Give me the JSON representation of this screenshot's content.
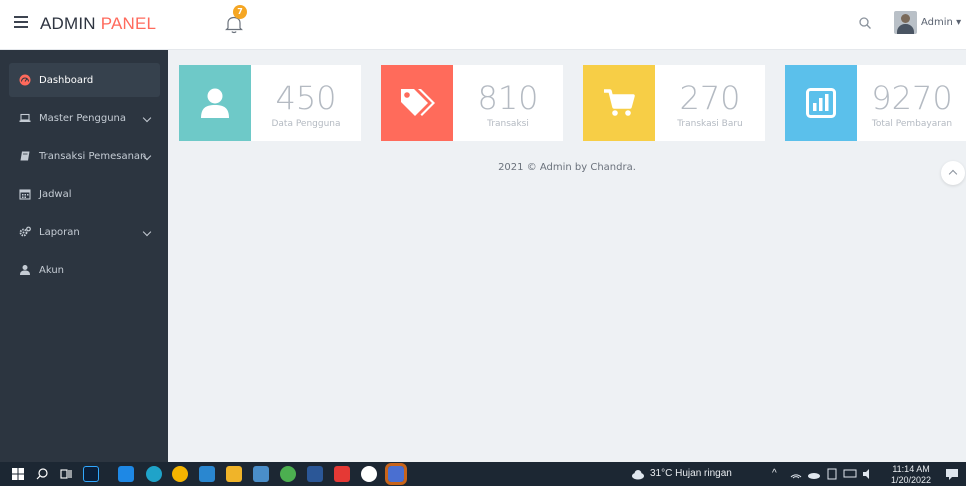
{
  "header": {
    "brand_part1": "ADMIN",
    "brand_part2": "PANEL",
    "notification_count": "7",
    "user_name": "Admin",
    "user_caret": "▾"
  },
  "sidebar": {
    "items": [
      {
        "label": "Dashboard",
        "icon": "dashboard-icon",
        "active": true
      },
      {
        "label": "Master Pengguna",
        "icon": "laptop-icon",
        "has_submenu": true
      },
      {
        "label": "Transaksi Pemesanan",
        "icon": "book-icon",
        "has_submenu": true
      },
      {
        "label": "Jadwal",
        "icon": "calendar-icon"
      },
      {
        "label": "Laporan",
        "icon": "cogs-icon",
        "has_submenu": true
      },
      {
        "label": "Akun",
        "icon": "user-icon"
      }
    ]
  },
  "cards": [
    {
      "value": "450",
      "label": "Data Pengguna",
      "color": "#6ec9c8",
      "icon": "user-icon"
    },
    {
      "value": "810",
      "label": "Transaksi",
      "color": "#ff6b5b",
      "icon": "tags-icon"
    },
    {
      "value": "270",
      "label": "Transkasi Baru",
      "color": "#f7ce46",
      "icon": "cart-icon"
    },
    {
      "value": "9270",
      "label": "Total Pembayaran",
      "color": "#5bc0eb",
      "icon": "bar-chart-icon"
    }
  ],
  "footer": {
    "text": "2021 © Admin by Chandra."
  },
  "taskbar": {
    "weather": "31°C  Hujan ringan",
    "time": "11:14 AM",
    "date": "1/20/2022"
  },
  "colors": {
    "sidebar_bg": "#2c3540",
    "sidebar_active": "#36414d",
    "brand_accent": "#ff6a5c",
    "badge": "#f5a623"
  }
}
